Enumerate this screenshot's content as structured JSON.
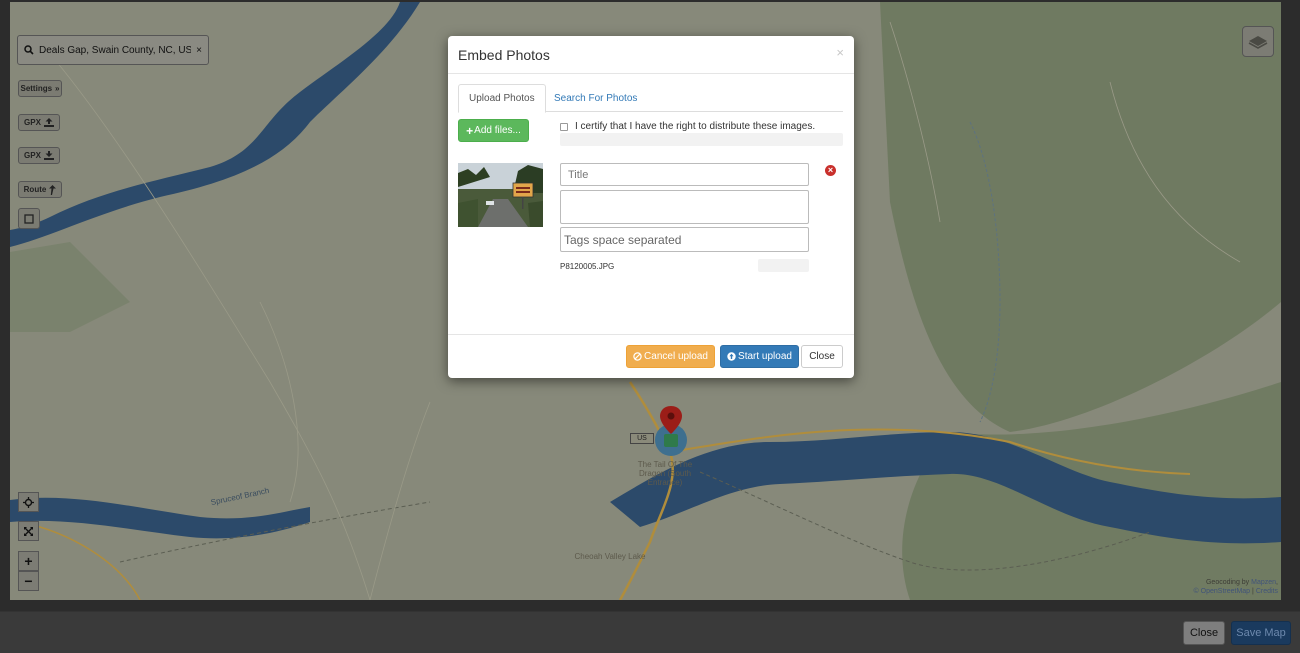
{
  "map": {
    "search_value": "Deals Gap, Swain County, NC, USA",
    "controls": {
      "settings_label": "Settings",
      "gpx_upload_label": "GPX",
      "gpx_download_label": "GPX",
      "route_label": "Route"
    },
    "labels": {
      "poi_line1": "The Tail Of The",
      "poi_line2": "Dragon (South",
      "poi_line3": "Entrance)",
      "lake": "Cheoah Valley Lake",
      "river": "Spruceof Branch",
      "route_shield": "US"
    },
    "attribution": {
      "line1_prefix": "Geocoding by",
      "line1_link": "Mapzen",
      "line2_link1": "© OpenStreetMap",
      "line2_sep": "|",
      "line2_link2": "Credits"
    },
    "zoom_in": "+",
    "zoom_out": "−"
  },
  "bottom": {
    "close_label": "Close",
    "save_label": "Save Map"
  },
  "modal": {
    "title": "Embed Photos",
    "close_x": "×",
    "tabs": [
      {
        "label": "Upload Photos",
        "active": true
      },
      {
        "label": "Search For Photos",
        "active": false
      }
    ],
    "add_files_label": "Add files...",
    "certify_label": "I certify that I have the right to distribute these images.",
    "photo": {
      "title_placeholder": "Title",
      "description_value": "",
      "tags_placeholder": "Tags space separated",
      "filename": "P8120005.JPG"
    },
    "footer": {
      "cancel_label": "Cancel upload",
      "start_label": "Start upload",
      "close_label": "Close"
    }
  },
  "colors": {
    "primary": "#337ab7",
    "success": "#5cb85c",
    "warning": "#f0ad4e",
    "danger": "#c9302c"
  }
}
